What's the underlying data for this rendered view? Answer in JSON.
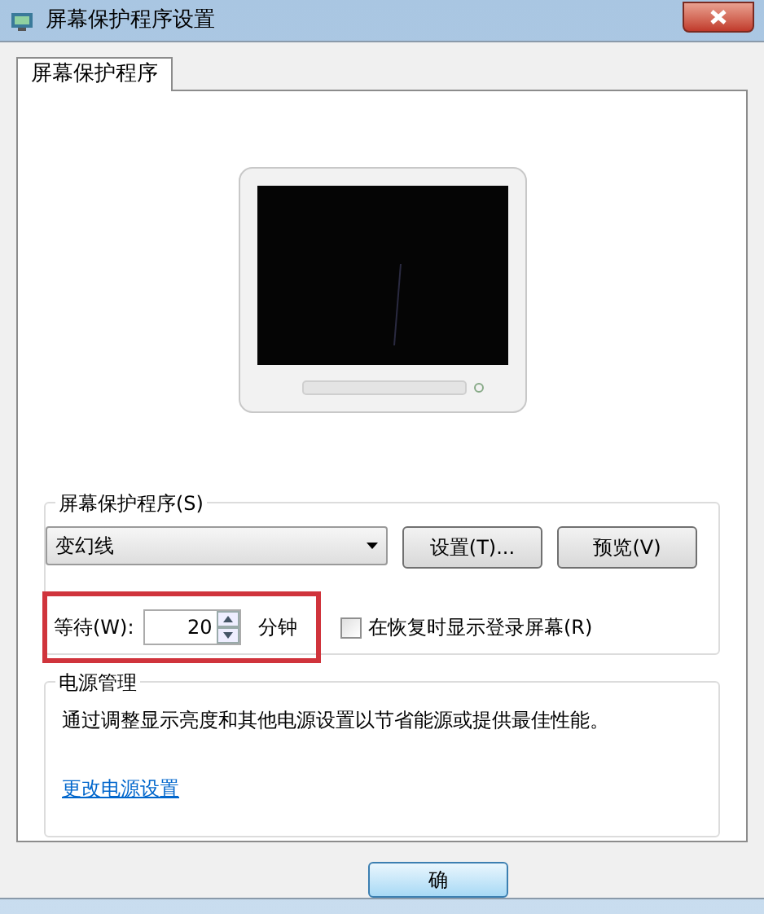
{
  "window": {
    "title": "屏幕保护程序设置"
  },
  "tabs": [
    {
      "label": "屏幕保护程序",
      "selected": true
    }
  ],
  "screensaver": {
    "legend": "屏幕保护程序(S)",
    "dropdown": {
      "value": "变幻线"
    },
    "buttons": [
      "设置(T)...",
      "预览(V)"
    ],
    "wait": {
      "label": "等待(W):",
      "value": "20",
      "unit": "分钟",
      "highlighted": true
    },
    "resume_checkbox": {
      "label": "在恢复时显示登录屏幕(R)",
      "checked": false
    }
  },
  "power": {
    "legend": "电源管理",
    "description": "通过调整显示亮度和其他电源设置以节省能源或提供最佳性能。",
    "link": "更改电源设置"
  },
  "footer_buttons": [
    "确"
  ]
}
